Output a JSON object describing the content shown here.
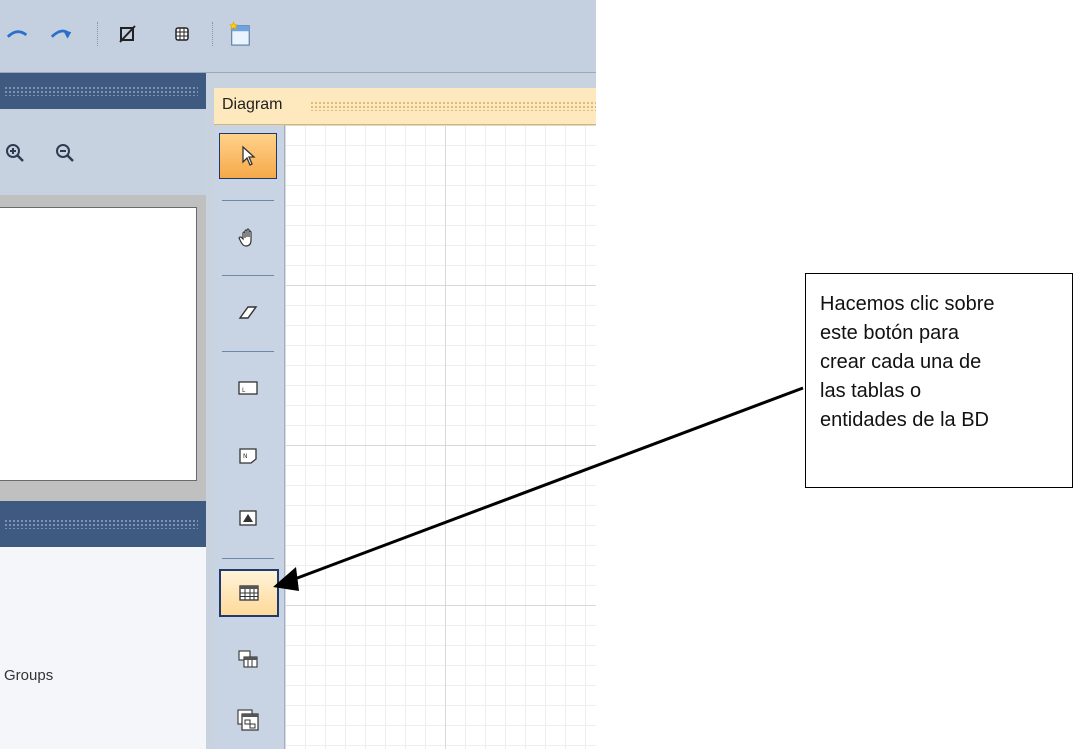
{
  "diagram": {
    "title": "Diagram"
  },
  "left_panel": {
    "groups_label": "Groups"
  },
  "callout": {
    "lines": [
      "Hacemos clic sobre",
      "este botón para",
      "crear cada una de",
      "las tablas o",
      "entidades de la BD"
    ]
  },
  "palette": {
    "tools": [
      "pointer",
      "pan",
      "eraser",
      "label",
      "note",
      "picture",
      "table",
      "view",
      "package"
    ]
  },
  "colors": {
    "diagram_header": "#fde9bd",
    "active_tool": "#f6a94a",
    "left_header": "#3e5a80",
    "toolbar": "#c4d0df"
  }
}
